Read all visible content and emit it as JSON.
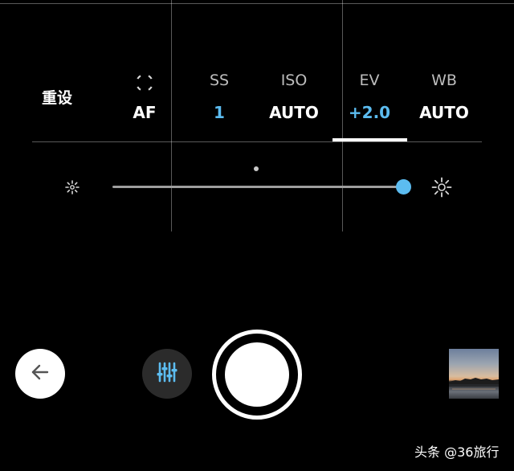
{
  "controls": {
    "reset_label": "重设",
    "params": [
      {
        "id": "focus",
        "label": "",
        "icon": "focus-ring-icon",
        "value": "AF",
        "active": false
      },
      {
        "id": "ss",
        "label": "SS",
        "value": "1",
        "active": false
      },
      {
        "id": "iso",
        "label": "ISO",
        "value": "AUTO",
        "active": false
      },
      {
        "id": "ev",
        "label": "EV",
        "value": "+2.0",
        "active": true
      },
      {
        "id": "wb",
        "label": "WB",
        "value": "AUTO",
        "active": false
      }
    ],
    "selected": "EV"
  },
  "ev_slider": {
    "value": 2.0,
    "min": -2.0,
    "max": 2.0,
    "min_icon": "brightness-low-icon",
    "max_icon": "brightness-high-icon"
  },
  "bottom_bar": {
    "back_icon": "arrow-left-icon",
    "settings_icon": "sliders-icon",
    "shutter_icon": "shutter-button",
    "thumbnail": "sunset-lake-photo"
  },
  "watermark": "头条 @36旅行",
  "colors": {
    "accent": "#5cbcf0",
    "background": "#000000",
    "text": "#ffffff",
    "label": "#bdbdbd"
  }
}
